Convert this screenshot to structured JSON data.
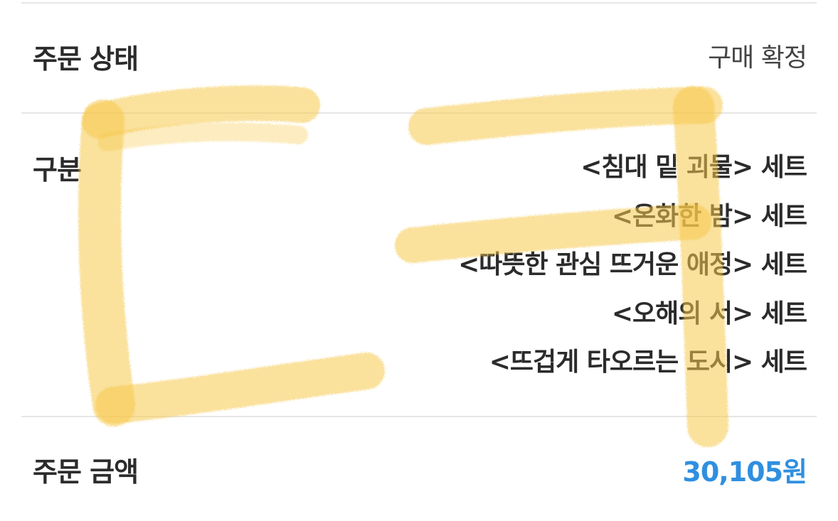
{
  "order_status": {
    "label": "주문 상태",
    "value": "구매 확정"
  },
  "category": {
    "label": "구분",
    "items": [
      "<침대 밑 괴물> 세트",
      "<온화한 밤> 세트",
      "<따뜻한 관심 뜨거운 애정> 세트",
      "<오해의 서> 세트",
      "<뜨겁게 타오르는 도시> 세트"
    ]
  },
  "order_amount": {
    "label": "주문 금액",
    "value": "30,105원"
  },
  "colors": {
    "amount": "#2f8fe0",
    "divider": "#e6e6e6",
    "highlight": "#f5c94a"
  },
  "overlay": {
    "type": "yellow crayon hand-drawn marks",
    "icon": "crayon-scribble"
  }
}
